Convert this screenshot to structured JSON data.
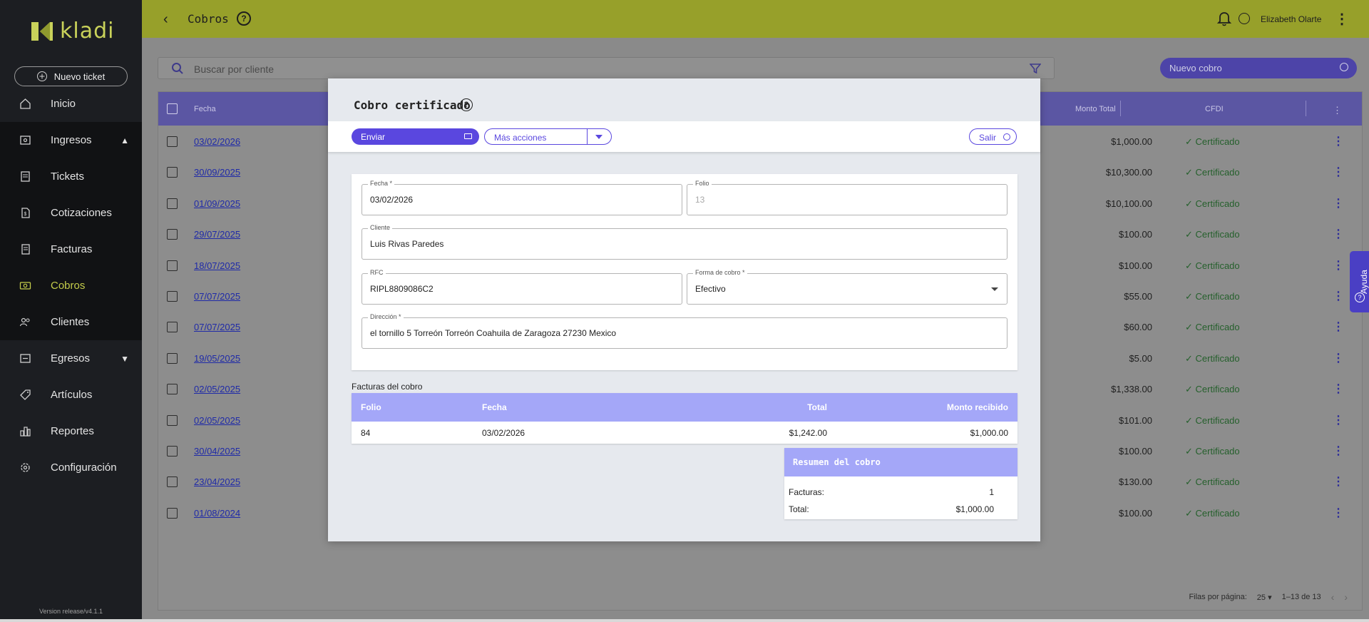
{
  "sidebar": {
    "logo_text": "kladi",
    "new_ticket": "Nuevo ticket",
    "items": [
      {
        "label": "Inicio",
        "icon": "home-icon"
      },
      {
        "label": "Ingresos",
        "icon": "income-icon",
        "expanded": true
      },
      {
        "label": "Tickets",
        "icon": "ticket-icon"
      },
      {
        "label": "Cotizaciones",
        "icon": "quote-icon"
      },
      {
        "label": "Facturas",
        "icon": "invoice-icon"
      },
      {
        "label": "Cobros",
        "icon": "cash-icon",
        "active": true
      },
      {
        "label": "Clientes",
        "icon": "clients-icon"
      },
      {
        "label": "Egresos",
        "icon": "expense-icon",
        "expanded": false
      },
      {
        "label": "Artículos",
        "icon": "tag-icon"
      },
      {
        "label": "Reportes",
        "icon": "chart-icon"
      },
      {
        "label": "Configuración",
        "icon": "gear-icon"
      }
    ],
    "version": "Version release/v4.1.1"
  },
  "topbar": {
    "title": "Cobros",
    "user": "Elizabeth Olarte"
  },
  "search": {
    "placeholder": "Buscar por cliente"
  },
  "new_cobro": "Nuevo cobro",
  "table": {
    "headers": {
      "fecha": "Fecha",
      "monto": "Monto Total",
      "cfdi": "CFDI"
    },
    "rows": [
      {
        "fecha": "03/02/2026",
        "monto": "$1,000.00",
        "cfdi": "✓ Certificado"
      },
      {
        "fecha": "30/09/2025",
        "monto": "$10,300.00",
        "cfdi": "✓ Certificado"
      },
      {
        "fecha": "01/09/2025",
        "monto": "$10,100.00",
        "cfdi": "✓ Certificado"
      },
      {
        "fecha": "29/07/2025",
        "monto": "$100.00",
        "cfdi": "✓ Certificado"
      },
      {
        "fecha": "18/07/2025",
        "monto": "$100.00",
        "cfdi": "✓ Certificado"
      },
      {
        "fecha": "07/07/2025",
        "monto": "$55.00",
        "cfdi": "✓ Certificado"
      },
      {
        "fecha": "07/07/2025",
        "monto": "$60.00",
        "cfdi": "✓ Certificado"
      },
      {
        "fecha": "19/05/2025",
        "monto": "$5.00",
        "cfdi": "✓ Certificado"
      },
      {
        "fecha": "02/05/2025",
        "monto": "$1,338.00",
        "cfdi": "✓ Certificado"
      },
      {
        "fecha": "02/05/2025",
        "monto": "$101.00",
        "cfdi": "✓ Certificado"
      },
      {
        "fecha": "30/04/2025",
        "monto": "$100.00",
        "cfdi": "✓ Certificado"
      },
      {
        "fecha": "23/04/2025",
        "monto": "$130.00",
        "cfdi": "✓ Certificado"
      },
      {
        "fecha": "01/08/2024",
        "monto": "$100.00",
        "cfdi": "✓ Certificado"
      }
    ],
    "footer": {
      "rows_per_page_label": "Filas por página:",
      "rows_per_page": "25",
      "range": "1–13 de 13"
    }
  },
  "help_tab": "Ayuda",
  "modal": {
    "title": "Cobro certificado",
    "enviar": "Enviar",
    "mas_acciones": "Más acciones",
    "salir": "Salir",
    "fields": {
      "fecha": {
        "label": "Fecha *",
        "value": "03/02/2026"
      },
      "folio": {
        "label": "Folio",
        "value": "13"
      },
      "cliente": {
        "label": "Cliente",
        "value": "Luis Rivas Paredes"
      },
      "rfc": {
        "label": "RFC",
        "value": "RIPL8809086C2"
      },
      "forma": {
        "label": "Forma de cobro *",
        "value": "Efectivo"
      },
      "direccion": {
        "label": "Dirección *",
        "value": "el tornillo 5 Torreón Torreón Coahuila de Zaragoza 27230 Mexico"
      }
    },
    "facturas_label": "Facturas del cobro",
    "facturas": {
      "headers": {
        "folio": "Folio",
        "fecha": "Fecha",
        "total": "Total",
        "monto": "Monto recibido"
      },
      "rows": [
        {
          "folio": "84",
          "fecha": "03/02/2026",
          "total": "$1,242.00",
          "monto": "$1,000.00"
        }
      ]
    },
    "resumen": {
      "title": "Resumen del cobro",
      "facturas_label": "Facturas:",
      "facturas_value": "1",
      "total_label": "Total:",
      "total_value": "$1,000.00"
    }
  },
  "colors": {
    "topbar": "#97a02a",
    "sidebar": "#1c1e22",
    "accent": "#5a47df",
    "table_header": "#a4a7f8",
    "certified": "#25602c"
  }
}
